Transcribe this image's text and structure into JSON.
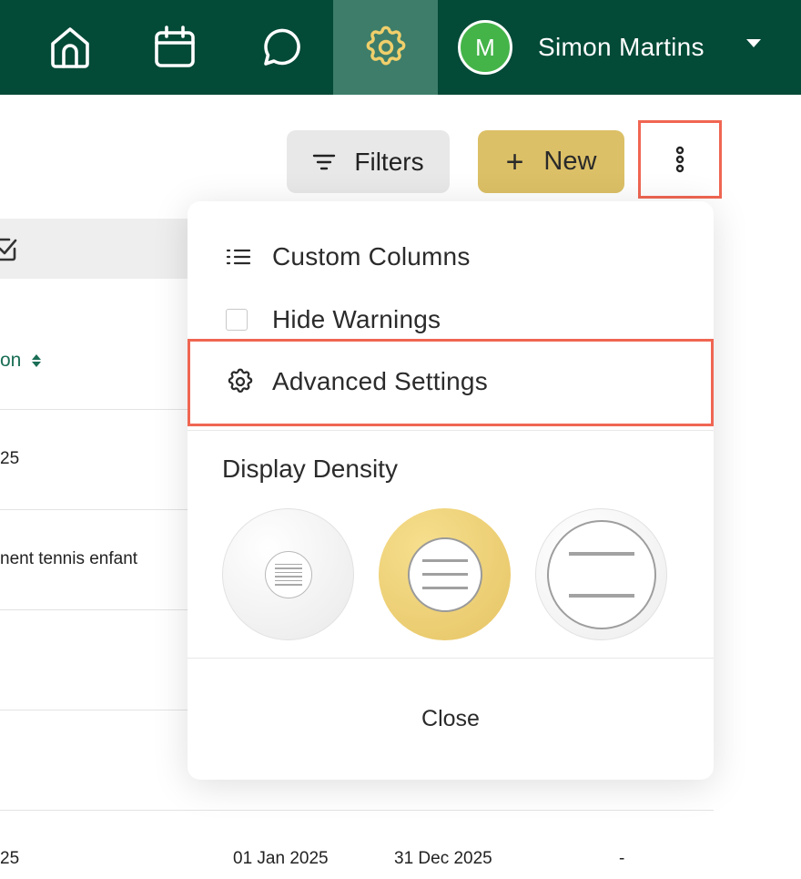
{
  "nav": {
    "items": [
      {
        "name": "home",
        "active": false
      },
      {
        "name": "calendar",
        "active": false
      },
      {
        "name": "messages",
        "active": false
      },
      {
        "name": "settings",
        "active": true
      }
    ],
    "user": {
      "initial": "M",
      "name": "Simon Martins"
    },
    "colors": {
      "bar": "#034a37",
      "active": "#3d7d6a",
      "active_icon": "#f0cf6b",
      "avatar": "#44b449"
    }
  },
  "toolbar": {
    "filters_label": "Filters",
    "new_label": "New",
    "new_icon": "+",
    "more_icon": "vertical-ellipsis-icon"
  },
  "table": {
    "column_header_fragment": "on",
    "rows": [
      {
        "text": "25"
      },
      {
        "text": "nent tennis enfant"
      },
      {
        "text": ""
      },
      {
        "text": ""
      },
      {
        "text": "25",
        "start": "01 Jan 2025",
        "end": "31 Dec 2025",
        "extra": "-"
      }
    ]
  },
  "menu": {
    "items": [
      {
        "label": "Custom Columns",
        "icon": "list-icon"
      },
      {
        "label": "Hide Warnings",
        "icon": "checkbox-icon",
        "checked": false
      },
      {
        "label": "Advanced Settings",
        "icon": "gear-icon"
      }
    ],
    "density_title": "Display Density",
    "density_options": [
      {
        "name": "compact",
        "selected": false
      },
      {
        "name": "standard",
        "selected": true
      },
      {
        "name": "comfortable",
        "selected": false
      }
    ],
    "close_label": "Close",
    "highlight_color": "#f06652"
  }
}
